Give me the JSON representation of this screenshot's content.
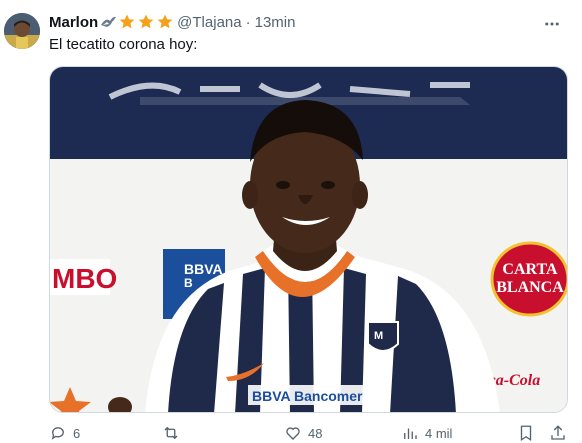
{
  "tweet": {
    "author_name": "Marlon",
    "badge_icons": [
      "eagle-badge-icon",
      "star-icon",
      "star-icon",
      "star-icon"
    ],
    "handle": "@Tlajana",
    "separator": "·",
    "timestamp": "13min",
    "text": "El tecatito corona hoy:",
    "media_alt": "Player in striped jersey at press conference",
    "media_signage": {
      "left_logo": "MBO",
      "bank": "BBVA",
      "bank_full": "BBVA Bancomer",
      "right_brand_line1": "CARTA",
      "right_brand_line2": "BLANCA",
      "sponsor_cola": "Coca-Cola"
    }
  },
  "actions": {
    "reply_count": "6",
    "retweet_count": "",
    "like_count": "48",
    "views_count": "4 mil"
  },
  "colors": {
    "text_primary": "#0f1419",
    "text_secondary": "#536471",
    "star": "#f4a21b",
    "jersey_navy": "#1f2a4a",
    "collar_orange": "#e8712a",
    "backdrop_navy": "#1d2b52"
  }
}
